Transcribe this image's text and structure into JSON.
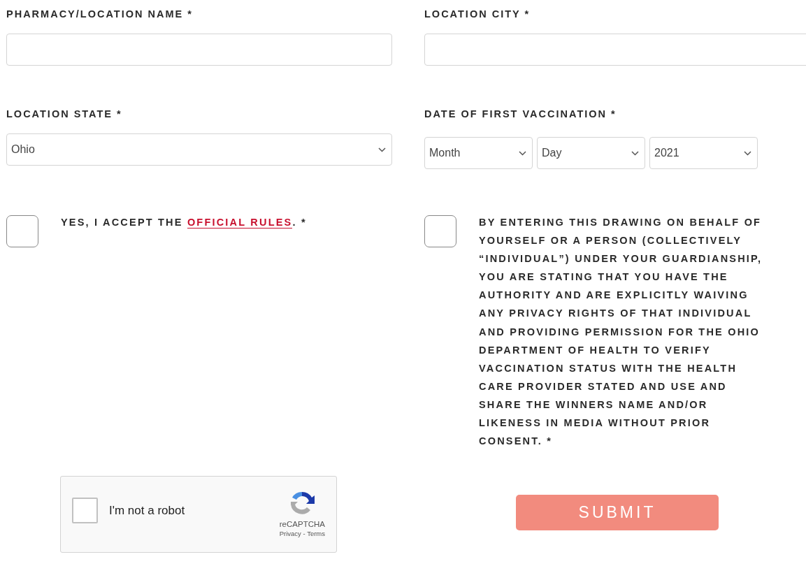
{
  "fields": [
    {
      "kind": "text",
      "label": "PHARMACY/LOCATION NAME *"
    },
    {
      "kind": "text",
      "label": "LOCATION CITY *"
    },
    {
      "kind": "select",
      "label": "LOCATION STATE *",
      "selects": [
        "Ohio"
      ]
    },
    {
      "kind": "select",
      "label": "DATE OF FIRST VACCINATION *",
      "selects": [
        "Month",
        "Day",
        "2021"
      ]
    }
  ],
  "consents": [
    {
      "text_before": "YES, I ACCEPT THE ",
      "link": "OFFICIAL RULES",
      "text_after": ". *",
      "checked": false
    },
    {
      "text_before": "BY ENTERING THIS DRAWING ON BEHALF OF YOURSELF OR A PERSON (COLLECTIVELY “INDIVIDUAL”) UNDER YOUR GUARDIANSHIP, YOU ARE STATING THAT YOU HAVE THE AUTHORITY AND ARE EXPLICITLY WAIVING ANY PRIVACY RIGHTS OF THAT INDIVIDUAL AND PROVIDING PERMISSION FOR THE OHIO DEPARTMENT OF HEALTH TO VERIFY VACCINATION STATUS WITH THE HEALTH CARE PROVIDER STATED AND USE AND SHARE THE WINNERS NAME AND/OR LIKENESS IN MEDIA WITHOUT PRIOR CONSENT. *",
      "checked": false
    }
  ],
  "captcha": {
    "label": "I'm not a robot",
    "checked": false,
    "brand": "reCAPTCHA",
    "footer": "Privacy - Terms"
  },
  "submit": {
    "label": "SUBMIT"
  }
}
